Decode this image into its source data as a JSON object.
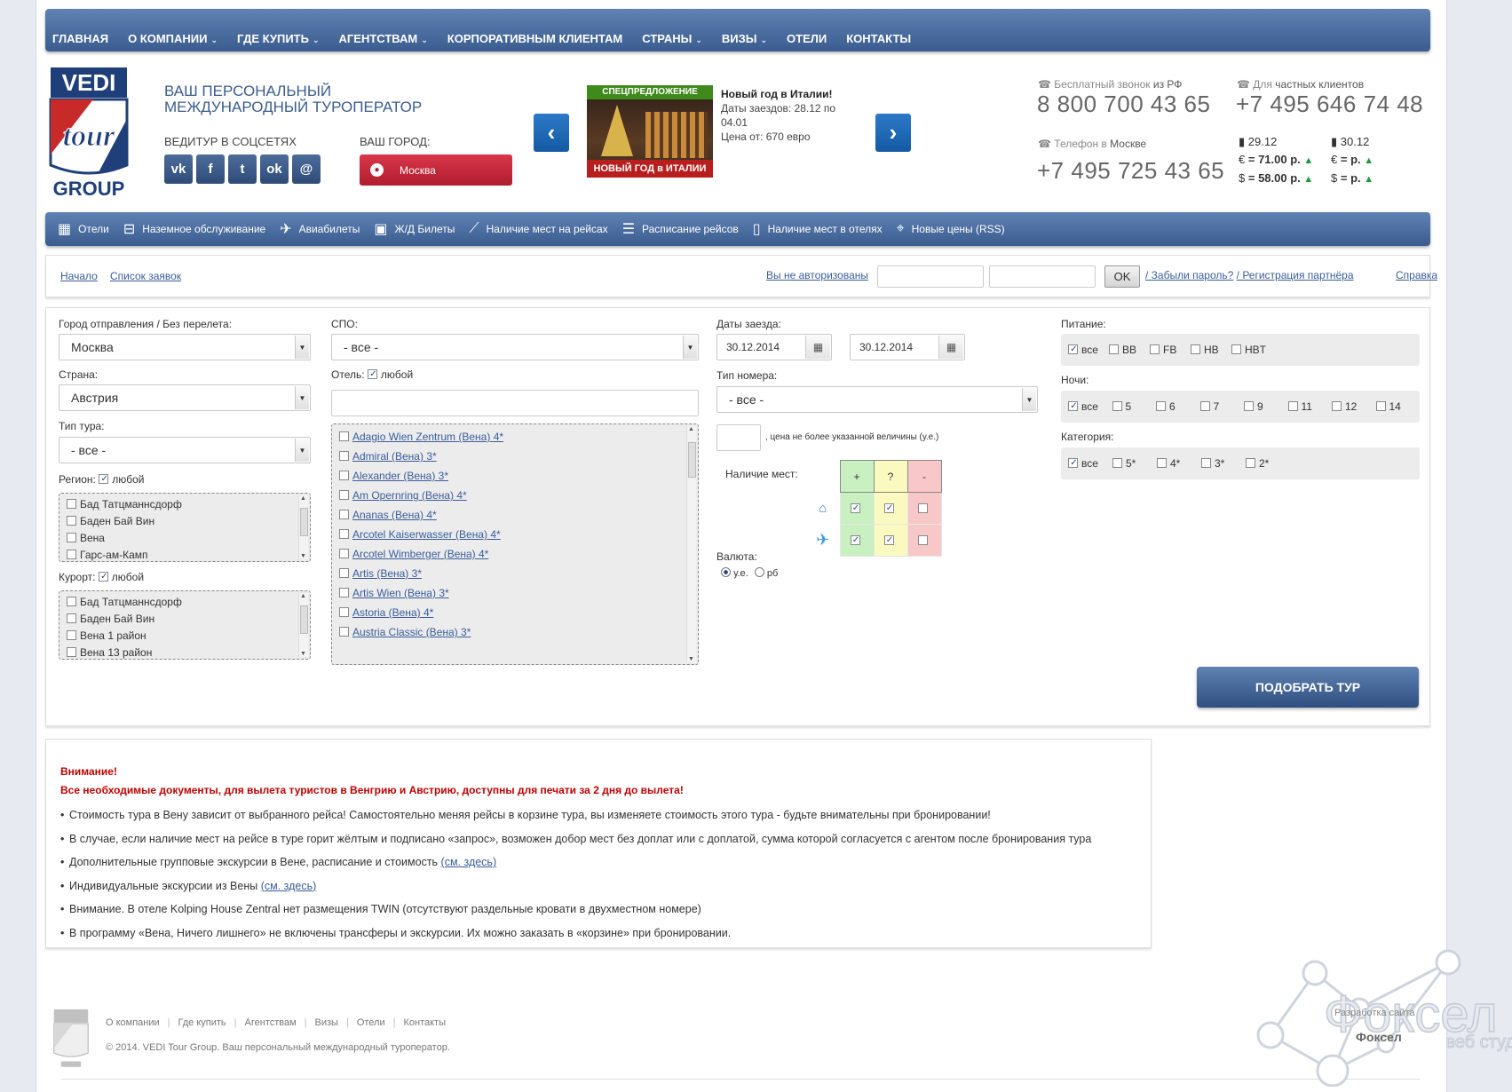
{
  "topnav": [
    {
      "label": "Главная",
      "dd": false
    },
    {
      "label": "О компании",
      "dd": true
    },
    {
      "label": "Где купить",
      "dd": true
    },
    {
      "label": "Агентствам",
      "dd": true
    },
    {
      "label": "Корпоративным клиентам",
      "dd": false
    },
    {
      "label": "Страны",
      "dd": true
    },
    {
      "label": "Визы",
      "dd": true
    },
    {
      "label": "Отели",
      "dd": false
    },
    {
      "label": "Контакты",
      "dd": false
    }
  ],
  "header": {
    "logo_top": "VEDI",
    "logo_mid": "tour",
    "logo_bot": "GROUP",
    "slogan1": "ВАШ ПЕРСОНАЛЬНЫЙ",
    "slogan2": "МЕЖДУНАРОДНЫЙ ТУРОПЕРАТОР",
    "social_label": "ВЕДИТУР В СОЦСЕТЯХ",
    "social": [
      "vk",
      "f",
      "t",
      "ok",
      "@"
    ],
    "city_label": "ВАШ ГОРОД:",
    "city": "Москва"
  },
  "promo": {
    "badge": "СПЕЦПРЕДЛОЖЕНИЕ",
    "caption": "НОВЫЙ ГОД в ИТАЛИИ",
    "title": "Новый год в Италии!",
    "line1": "Даты заездов: 28.12 по",
    "line2": "04.01",
    "line3": "Цена от: 670 евро"
  },
  "contacts": {
    "free_lbl": "Бесплатный звонок",
    "free_lbl2": "из РФ",
    "free_phone": "8 800 700 43 65",
    "priv_lbl": "Для",
    "priv_lbl2": "частных клиентов",
    "priv_phone": "+7 495 646 74 48",
    "msk_lbl": "Телефон в",
    "msk_lbl2": "Москве",
    "msk_phone": "+7 495 725 43 65"
  },
  "rates": {
    "d1": "29.12",
    "d2": "30.12",
    "eur1": "= 71.00 р.",
    "usd1": "= 58.00 р.",
    "eur2": "= р.",
    "usd2": "= р.",
    "eur_sym": "€",
    "usd_sym": "$"
  },
  "services": [
    {
      "icon": "calendar-icon",
      "glyph": "▦",
      "label": "Отели"
    },
    {
      "icon": "bus-icon",
      "glyph": "⊟",
      "label": "Наземное обслуживание"
    },
    {
      "icon": "plane-icon",
      "glyph": "✈",
      "label": "Авиабилеты"
    },
    {
      "icon": "train-icon",
      "glyph": "▣",
      "label": "Ж/Д Билеты"
    },
    {
      "icon": "takeoff-icon",
      "glyph": "⟋",
      "label": "Наличие мест на рейсах"
    },
    {
      "icon": "schedule-icon",
      "glyph": "☰",
      "label": "Расписание рейсов"
    },
    {
      "icon": "phone-icon",
      "glyph": "▯",
      "label": "Наличие мест в отелях"
    },
    {
      "icon": "tag-icon",
      "glyph": "⌖",
      "label": "Новые цены (RSS)"
    }
  ],
  "auth": {
    "start": "Начало",
    "orders": "Список заявок",
    "not_auth": "Вы не авторизованы",
    "ok": "OK",
    "forgot": "/ Забыли пароль?",
    "register": "/ Регистрация партнёра",
    "help": "Справка"
  },
  "form": {
    "city_lbl": "Город отправления / Без перелета:",
    "city_val": "Москва",
    "country_lbl": "Страна:",
    "country_val": "Австрия",
    "tourtype_lbl": "Тип тура:",
    "tourtype_val": "- все -",
    "region_lbl": "Регион:",
    "any": "любой",
    "regions": [
      "Бад Татцманнсдорф",
      "Баден Бай Вин",
      "Вена",
      "Гарс-ам-Камп"
    ],
    "resort_lbl": "Курорт:",
    "resorts": [
      "Бад Татцманнсдорф",
      "Баден Бай Вин",
      "Вена 1 район",
      "Вена 13 район"
    ],
    "spo_lbl": "СПО:",
    "spo_val": "- все -",
    "hotel_lbl": "Отель:",
    "hotels": [
      "Adagio Wien Zentrum (Вена) 4*",
      "Admiral (Вена) 3*",
      "Alexander (Вена) 3*",
      "Am Opernring (Вена) 4*",
      "Ananas (Вена) 4*",
      "Arcotel Kaiserwasser (Вена) 4*",
      "Arcotel Wimberger (Вена) 4*",
      "Artis (Вена) 3*",
      "Artis Wien (Вена) 3*",
      "Astoria (Вена) 4*",
      "Austria Classic (Вена) 3*"
    ],
    "dates_lbl": "Даты заезда:",
    "date_from": "30.12.2014",
    "date_to": "30.12.2014",
    "room_lbl": "Тип номера:",
    "room_val": "- все -",
    "price_note": ", цена не более указанной величины (у.е.)",
    "avail_lbl": "Наличие мест:",
    "avail_h": [
      "+",
      "?",
      "-"
    ],
    "currency_lbl": "Валюта:",
    "cur1": "у.е.",
    "cur2": "рб",
    "meal_lbl": "Питание:",
    "meals": [
      "все",
      "BB",
      "FB",
      "HB",
      "HBT"
    ],
    "nights_lbl": "Ночи:",
    "nights": [
      "все",
      "5",
      "6",
      "7",
      "9",
      "11",
      "12",
      "14"
    ],
    "cat_lbl": "Категория:",
    "cats": [
      "все",
      "5*",
      "4*",
      "3*",
      "2*"
    ],
    "submit": "ПОДОБРАТЬ ТУР"
  },
  "notice": {
    "title": "Внимание!",
    "subtitle": "Все необходимые документы, для вылета туристов в Венгрию и Австрию, доступны для печати за 2 дня до вылета!",
    "items": [
      {
        "text": "Стоимость тура в Вену зависит от выбранного рейса! Самостоятельно меняя рейсы в корзине тура, вы изменяете стоимость этого тура - будьте внимательны при бронировании!",
        "link": ""
      },
      {
        "text": "В случае, если наличие мест на рейсе в туре горит жёлтым и подписано «запрос», возможен добор мест без доплат или с доплатой, сумма которой согласуется с агентом после бронирования тура",
        "link": ""
      },
      {
        "text": "Дополнительные групповые экскурсии в Вене, расписание и стоимость ",
        "link": "(см. здесь)"
      },
      {
        "text": "Индивидуальные экскурсии из Вены ",
        "link": "(см. здесь)"
      },
      {
        "text": "Внимание. В отеле Kolping House Zentral нет размещения TWIN (отсутствуют раздельные кровати в двухместном номере)",
        "link": ""
      },
      {
        "text": "В программу «Вена, Ничего лишнего» не включены трансферы и экскурсии. Их можно заказать в «корзине» при бронировании.",
        "link": ""
      }
    ]
  },
  "footer": {
    "links": [
      "О компании",
      "Где купить",
      "Агентствам",
      "Визы",
      "Отели",
      "Контакты"
    ],
    "copy": "© 2014. VEDI Tour Group. Ваш персональный международный туроператор.",
    "dev_lbl": "Разработка сайта",
    "dev_name": "Фоксел",
    "brand": "Фоксел",
    "brand_sub": "веб студия"
  },
  "colors": {
    "nav": "#3a5c8e",
    "accent_red": "#c00000",
    "link": "#3a5c9a"
  }
}
